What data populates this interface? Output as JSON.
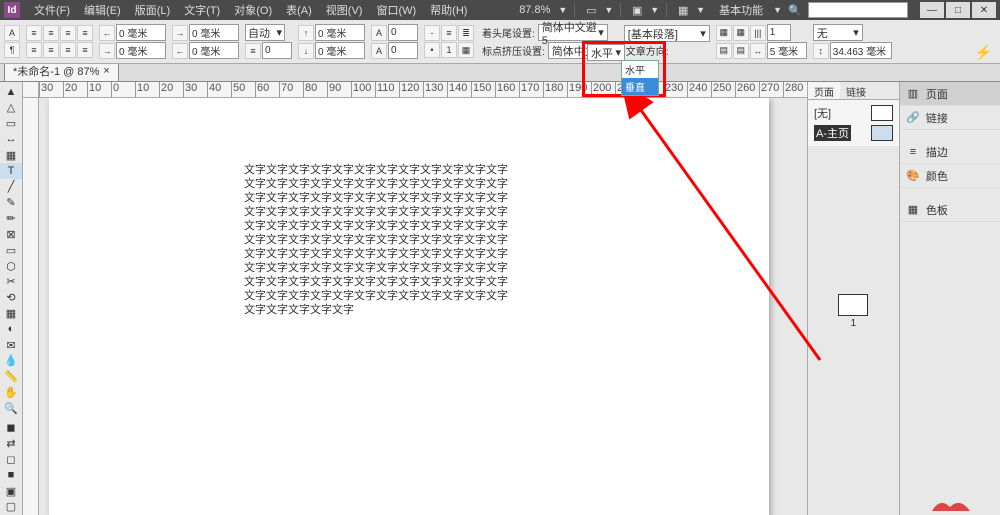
{
  "app": {
    "logo": "Id"
  },
  "menu": {
    "file": "文件(F)",
    "edit": "编辑(E)",
    "layout": "版面(L)",
    "type": "文字(T)",
    "object": "对象(O)",
    "table": "表(A)",
    "view": "视图(V)",
    "window": "窗口(W)",
    "help": "帮助(H)"
  },
  "topbar": {
    "zoom": "87.8%",
    "workspace": "基本功能",
    "search_placeholder": ""
  },
  "control": {
    "indent1": "0 毫米",
    "indent2": "0 毫米",
    "indent3": "0 毫米",
    "indent4": "0 毫米",
    "auto": "自动",
    "lines": "0",
    "sp_before": "0 毫米",
    "sp_after": "0 毫米",
    "dc_lines": "0",
    "dc_chars": "0",
    "kenten_label": "着头尾设置:",
    "kenten_val": "简体中文避5",
    "mojikumi_label": "标点挤压设置:",
    "mojikumi_val": "简体中文默",
    "para_style": "[基本段落]",
    "direction_label": "文章方向:",
    "direction_val": "水平",
    "cols": "1",
    "span": "无",
    "gutter": "5 毫米",
    "height": "34.463 毫米",
    "dropdown": {
      "opt1": "水平",
      "opt2": "垂直"
    }
  },
  "doc": {
    "tab": "*未命名-1 @ 87%",
    "close": "×"
  },
  "ruler": {
    "marks": [
      "30",
      "20",
      "10",
      "0",
      "10",
      "20",
      "30",
      "40",
      "50",
      "60",
      "70",
      "80",
      "90",
      "100",
      "110",
      "120",
      "130",
      "140",
      "150",
      "160",
      "170",
      "180",
      "190",
      "200",
      "210",
      "220",
      "230",
      "240",
      "250",
      "260",
      "270",
      "280"
    ]
  },
  "text": {
    "l1": "文字文字文字文字文字文字文字文字文字文字文字文字",
    "l2": "文字文字文字文字文字文字文字文字文字文字文字文字",
    "l3": "文字文字文字文字文字文字文字文字文字文字文字文字",
    "l4": "文字文字文字文字文字文字文字文字文字文字文字文字",
    "l5": "文字文字文字文字文字文字文字文字文字文字文字文字",
    "l6": "文字文字文字文字文字文字文字文字文字文字文字文字",
    "l7": "文字文字文字文字文字文字文字文字文字文字文字文字",
    "l8": "文字文字文字文字文字文字文字文字文字文字文字文字",
    "l9": "文字文字文字文字文字文字文字文字文字文字文字文字",
    "l10": "文字文字文字文字文字文字文字文字文字文字文字文字",
    "l11": "文字文字文字文字文字"
  },
  "right": {
    "tab_pages": "页面",
    "tab_links": "链接",
    "none": "[无]",
    "master": "A-主页",
    "page1": "1"
  },
  "far": {
    "pages": "页面",
    "links": "链接",
    "stroke": "描边",
    "color": "颜色",
    "swatches": "色板"
  }
}
